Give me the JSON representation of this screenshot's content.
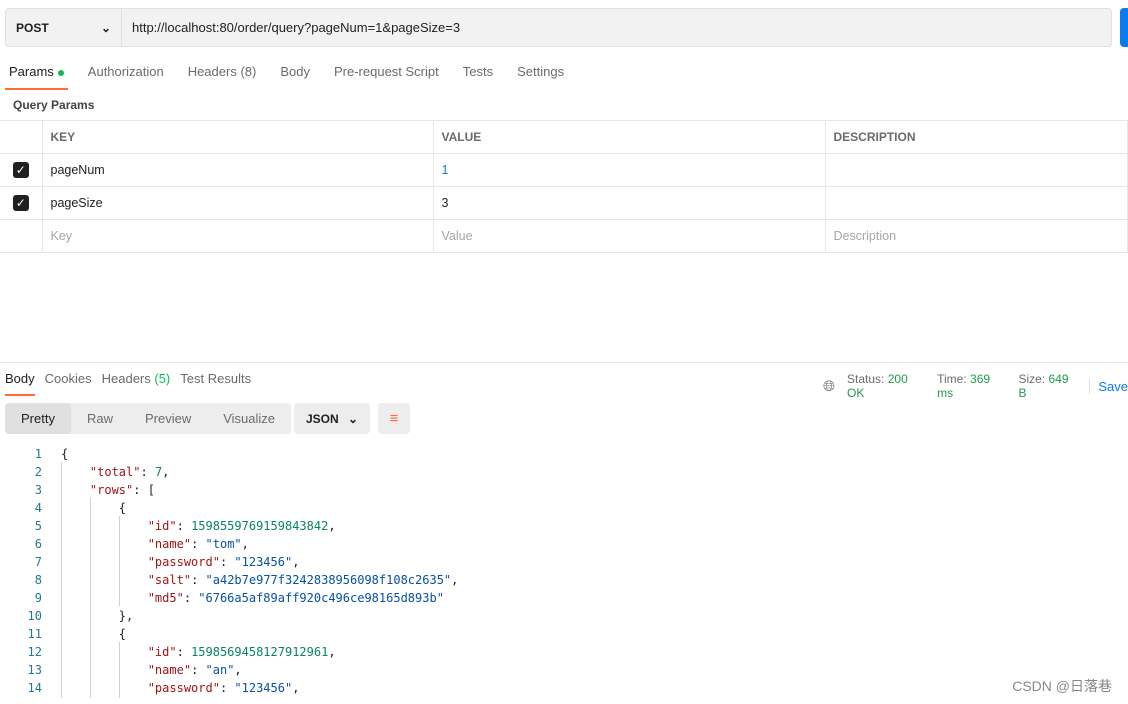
{
  "request": {
    "method": "POST",
    "url": "http://localhost:80/order/query?pageNum=1&pageSize=3"
  },
  "tabs": [
    {
      "label": "Params"
    },
    {
      "label": "Authorization"
    },
    {
      "label": "Headers",
      "count": "(8)"
    },
    {
      "label": "Body"
    },
    {
      "label": "Pre-request Script"
    },
    {
      "label": "Tests"
    },
    {
      "label": "Settings"
    }
  ],
  "query_params": {
    "title": "Query Params",
    "headers": [
      "KEY",
      "VALUE",
      "DESCRIPTION"
    ],
    "rows": [
      {
        "key": "pageNum",
        "value": "1",
        "checked": true
      },
      {
        "key": "pageSize",
        "value": "3",
        "checked": true
      }
    ],
    "placeholders": {
      "key": "Key",
      "value": "Value",
      "description": "Description"
    }
  },
  "response": {
    "tabs": [
      "Body",
      "Cookies",
      "Headers",
      "Test Results"
    ],
    "headers_count": "(5)",
    "status_label": "Status:",
    "status": "200 OK",
    "time_label": "Time:",
    "time": "369 ms",
    "size_label": "Size:",
    "size": "649 B",
    "save": "Save",
    "views": [
      "Pretty",
      "Raw",
      "Preview",
      "Visualize"
    ],
    "format": "JSON",
    "lines": [
      [
        [
          "p",
          "{"
        ]
      ],
      [
        [
          "p",
          "    "
        ],
        [
          "k",
          "\"total\""
        ],
        [
          "p",
          ": "
        ],
        [
          "n",
          "7"
        ],
        [
          "p",
          ","
        ]
      ],
      [
        [
          "p",
          "    "
        ],
        [
          "k",
          "\"rows\""
        ],
        [
          "p",
          ": ["
        ]
      ],
      [
        [
          "p",
          "        {"
        ]
      ],
      [
        [
          "p",
          "            "
        ],
        [
          "k",
          "\"id\""
        ],
        [
          "p",
          ": "
        ],
        [
          "n",
          "1598559769159843842"
        ],
        [
          "p",
          ","
        ]
      ],
      [
        [
          "p",
          "            "
        ],
        [
          "k",
          "\"name\""
        ],
        [
          "p",
          ": "
        ],
        [
          "s",
          "\"tom\""
        ],
        [
          "p",
          ","
        ]
      ],
      [
        [
          "p",
          "            "
        ],
        [
          "k",
          "\"password\""
        ],
        [
          "p",
          ": "
        ],
        [
          "s",
          "\"123456\""
        ],
        [
          "p",
          ","
        ]
      ],
      [
        [
          "p",
          "            "
        ],
        [
          "k",
          "\"salt\""
        ],
        [
          "p",
          ": "
        ],
        [
          "s",
          "\"a42b7e977f3242838956098f108c2635\""
        ],
        [
          "p",
          ","
        ]
      ],
      [
        [
          "p",
          "            "
        ],
        [
          "k",
          "\"md5\""
        ],
        [
          "p",
          ": "
        ],
        [
          "s",
          "\"6766a5af89aff920c496ce98165d893b\""
        ]
      ],
      [
        [
          "p",
          "        },"
        ]
      ],
      [
        [
          "p",
          "        {"
        ]
      ],
      [
        [
          "p",
          "            "
        ],
        [
          "k",
          "\"id\""
        ],
        [
          "p",
          ": "
        ],
        [
          "n",
          "1598569458127912961"
        ],
        [
          "p",
          ","
        ]
      ],
      [
        [
          "p",
          "            "
        ],
        [
          "k",
          "\"name\""
        ],
        [
          "p",
          ": "
        ],
        [
          "s",
          "\"an\""
        ],
        [
          "p",
          ","
        ]
      ],
      [
        [
          "p",
          "            "
        ],
        [
          "k",
          "\"password\""
        ],
        [
          "p",
          ": "
        ],
        [
          "s",
          "\"123456\""
        ],
        [
          "p",
          ","
        ]
      ]
    ]
  },
  "watermark": "CSDN @日落巷",
  "colors": {
    "accent": "#ff6c37",
    "send": "#097bed",
    "key": "#a31515",
    "string": "#0451a5",
    "number": "#098658"
  }
}
